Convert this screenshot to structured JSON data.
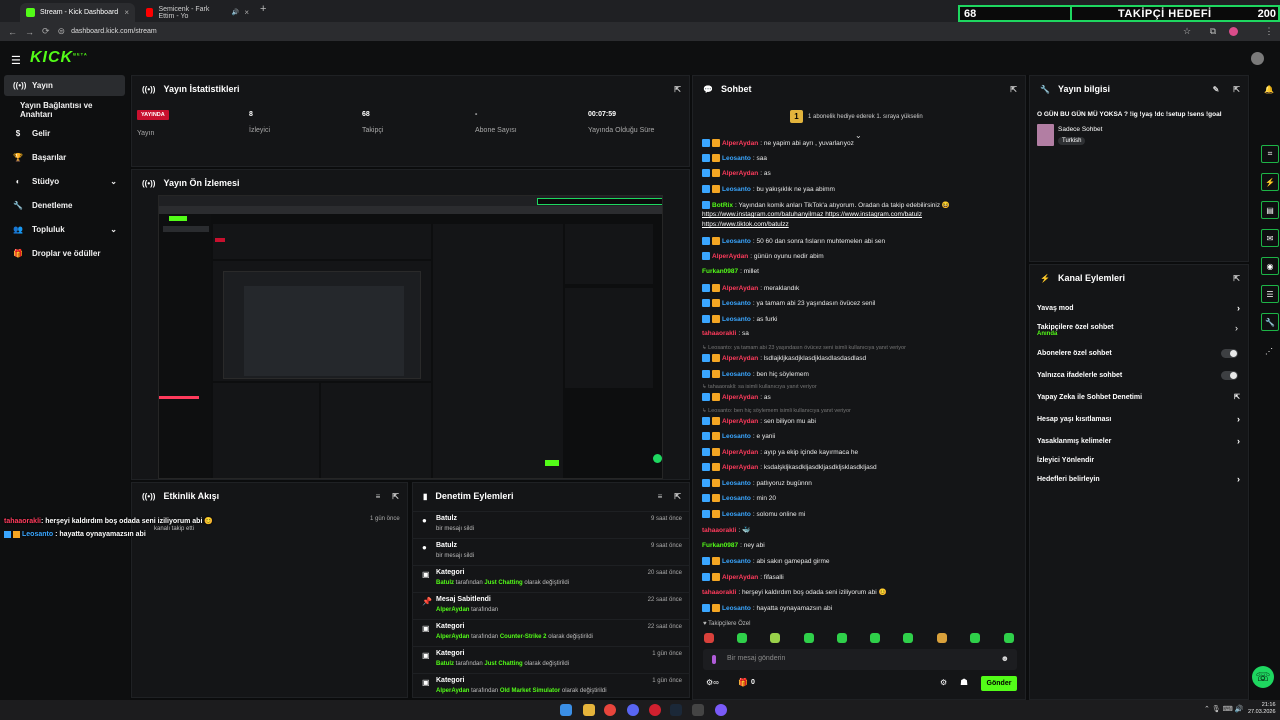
{
  "browser": {
    "tabs": [
      {
        "title": "Stream - Kick Dashboard",
        "active": true,
        "favicon_color": "#53fc18"
      },
      {
        "title": "Semicenk - Fark Ettim - Yo",
        "active": false,
        "favicon_color": "#ff0000"
      }
    ],
    "url": "dashboard.kick.com/stream"
  },
  "overlay": {
    "count": "68",
    "label": "TAKİPÇİ HEDEFİ",
    "goal": "200"
  },
  "kick": {
    "logo": "KICK",
    "beta": "BETA"
  },
  "sidebar": {
    "items": [
      {
        "label": "Yayın",
        "icon": "broadcast-icon"
      },
      {
        "label": "Yayın Bağlantısı ve Anahtarı",
        "icon": ""
      },
      {
        "label": "Gelir",
        "icon": "dollar-icon"
      },
      {
        "label": "Başarılar",
        "icon": "trophy-icon"
      },
      {
        "label": "Stüdyo",
        "icon": "palette-icon"
      },
      {
        "label": "Denetleme",
        "icon": "wrench-icon"
      },
      {
        "label": "Topluluk",
        "icon": "users-icon"
      },
      {
        "label": "Droplar ve ödüller",
        "icon": "gift-icon"
      }
    ]
  },
  "stats": {
    "title": "Yayın İstatistikleri",
    "live_badge": "YAYINDA",
    "live_label": "Yayın",
    "viewers_value": "8",
    "viewers_label": "İzleyici",
    "followers_value": "68",
    "followers_label": "Takipçi",
    "subs_value": "-",
    "subs_label": "Abone Sayısı",
    "duration_value": "00:07:59",
    "duration_label": "Yayında Olduğu Süre"
  },
  "preview": {
    "title": "Yayın Ön İzlemesi"
  },
  "activity": {
    "title": "Etkinlik Akışı",
    "item_time": "1 gün önce",
    "item_text": "kanalı takip etti",
    "overlay_msgs": [
      {
        "user": "tahaaorakli",
        "text": ": herşeyi kaldırdım boş odada seni iziliyorum abi 😊"
      },
      {
        "user": "Leosanto",
        "text": ": hayatta oynayamazsın abi"
      }
    ]
  },
  "moderation": {
    "title": "Denetim Eylemleri",
    "items": [
      {
        "icon": "user-icon",
        "title": "Batulz",
        "sub": "bir mesajı sildi",
        "time": "9 saat önce"
      },
      {
        "icon": "user-icon",
        "title": "Batulz",
        "sub": "bir mesajı sildi",
        "time": "9 saat önce"
      },
      {
        "icon": "category-icon",
        "title": "Kategori",
        "sub_user": "Batulz",
        "sub_mid": "tarafından",
        "sub_game": "Just Chatting",
        "sub_end": "olarak değiştirildi",
        "time": "20 saat önce"
      },
      {
        "icon": "pin-icon",
        "title": "Mesaj Sabitlendi",
        "sub_user": "AlperAydan",
        "sub_mid": "tarafından",
        "sub_game": "",
        "sub_end": "",
        "time": "22 saat önce"
      },
      {
        "icon": "category-icon",
        "title": "Kategori",
        "sub_user": "AlperAydan",
        "sub_mid": "tarafından",
        "sub_game": "Counter-Strike 2",
        "sub_end": "olarak değiştirildi",
        "time": "22 saat önce"
      },
      {
        "icon": "category-icon",
        "title": "Kategori",
        "sub_user": "Batulz",
        "sub_mid": "tarafından",
        "sub_game": "Just Chatting",
        "sub_end": "olarak değiştirildi",
        "time": "1 gün önce"
      },
      {
        "icon": "category-icon",
        "title": "Kategori",
        "sub_user": "AlperAydan",
        "sub_mid": "tarafından",
        "sub_game": "Old Market Simulator",
        "sub_end": "olarak değiştirildi",
        "time": "1 gün önce"
      }
    ]
  },
  "chat": {
    "title": "Sohbet",
    "gift_banner": "1 abonelik hediye ederek 1. sıraya yükselin",
    "messages": [
      {
        "user": "AlperAydan",
        "color": "#ff3b5c",
        "text": ": ne yapim abi ayrı , yuvarlarıyoz",
        "badges": 2
      },
      {
        "user": "Leosanto",
        "color": "#3aa6ff",
        "text": ": saa",
        "badges": 2
      },
      {
        "user": "AlperAydan",
        "color": "#ff3b5c",
        "text": ": as",
        "badges": 2
      },
      {
        "user": "Leosanto",
        "color": "#3aa6ff",
        "text": ": bu yakışıklık ne yaa abimm",
        "badges": 2
      },
      {
        "user": "BotRix",
        "color": "#53fc18",
        "text": ": Yayından komik anları TikTok'a atıyorum. Oradan da takip edebilirsiniz 😆",
        "badges": 1
      },
      {
        "user": "",
        "color": "#fff",
        "text": "https://www.instagram.com/batuhanyilmaz https://www.instagram.com/batulz",
        "badges": 0
      },
      {
        "user": "",
        "color": "#fff",
        "text": "https://www.tiktok.com/batulzz",
        "badges": 0
      },
      {
        "user": "Leosanto",
        "color": "#3aa6ff",
        "text": ": 50 60 dan sonra fısların muhtemelen abi sen",
        "badges": 2
      },
      {
        "user": "AlperAydan",
        "color": "#ff3b5c",
        "text": ": günün oyunu nedir abim",
        "badges": 1
      },
      {
        "user": "Furkan0987",
        "color": "#53fc18",
        "text": ": millet",
        "badges": 0
      },
      {
        "user": "AlperAydan",
        "color": "#ff3b5c",
        "text": ": meraklandık",
        "badges": 2
      },
      {
        "user": "Leosanto",
        "color": "#3aa6ff",
        "text": ": ya tamam abi 23 yaşındasın övücez senil",
        "badges": 2
      },
      {
        "user": "Leosanto",
        "color": "#3aa6ff",
        "text": ": as furki",
        "badges": 2
      },
      {
        "user": "tahaaorakli",
        "color": "#ff3b5c",
        "text": ": sa",
        "badges": 0
      },
      {
        "user": "",
        "color": "#777",
        "text": "↳ Leosanto: ya tamam abi 23 yaşındasın övücez seni isimli kullanıcıya yanıt veriyor",
        "badges": 0
      },
      {
        "user": "AlperAydan",
        "color": "#ff3b5c",
        "text": ": lsdlajkljkasdjklasdjklasdlasdasdlasd",
        "badges": 2
      },
      {
        "user": "Leosanto",
        "color": "#3aa6ff",
        "text": ": ben hiç söylemem",
        "badges": 2
      },
      {
        "user": "",
        "color": "#777",
        "text": "↳ tahaaorakli: sa isimli kullanıcıya yanıt veriyor",
        "badges": 0
      },
      {
        "user": "AlperAydan",
        "color": "#ff3b5c",
        "text": ": as",
        "badges": 2
      },
      {
        "user": "",
        "color": "#777",
        "text": "↳ Leosanto: ben hiç söylemem isimli kullanıcıya yanıt veriyor",
        "badges": 0
      },
      {
        "user": "AlperAydan",
        "color": "#ff3b5c",
        "text": ": sen biliyon mu abi",
        "badges": 2
      },
      {
        "user": "Leosanto",
        "color": "#3aa6ff",
        "text": ": e yanii",
        "badges": 2
      },
      {
        "user": "AlperAydan",
        "color": "#ff3b5c",
        "text": ": ayıp ya ekip içinde kayırmaca he",
        "badges": 2
      },
      {
        "user": "AlperAydan",
        "color": "#ff3b5c",
        "text": ": ksdalşkljkasdkljasdkljasdkljsklasdkljasd",
        "badges": 2
      },
      {
        "user": "Leosanto",
        "color": "#3aa6ff",
        "text": ": patlıyoruz bugünnn",
        "badges": 2
      },
      {
        "user": "Leosanto",
        "color": "#3aa6ff",
        "text": ": min 20",
        "badges": 2
      },
      {
        "user": "Leosanto",
        "color": "#3aa6ff",
        "text": ": solomu online mi",
        "badges": 2
      },
      {
        "user": "tahaaorakli",
        "color": "#ff3b5c",
        "text": ": 🐳",
        "badges": 0
      },
      {
        "user": "Furkan0987",
        "color": "#53fc18",
        "text": ": ney abi",
        "badges": 0
      },
      {
        "user": "Leosanto",
        "color": "#3aa6ff",
        "text": ": abi sakın gamepad girme",
        "badges": 2
      },
      {
        "user": "AlperAydan",
        "color": "#ff3b5c",
        "text": ": fifasalli",
        "badges": 2
      },
      {
        "user": "tahaaorakli",
        "color": "#ff3b5c",
        "text": ": herşeyi kaldırdım boş odada seni iziliyorum abi 😊",
        "badges": 0
      },
      {
        "user": "Leosanto",
        "color": "#3aa6ff",
        "text": ": hayatta oynayamazsın abi",
        "badges": 2
      }
    ],
    "followers_only": "♥ Takipçilere Özel",
    "input_placeholder": "Bir mesaj gönderin",
    "footer_count": "0",
    "send_label": "Gönder"
  },
  "stream_info": {
    "title": "Yayın bilgisi",
    "stream_title": "O GÜN BU GÜN MÜ YOKSA ? !ig !yaş !dc !setup !sens !goal",
    "category": "Sadece Sohbet",
    "language": "Turkish"
  },
  "channel_actions": {
    "title": "Kanal Eylemleri",
    "items": [
      {
        "label": "Yavaş mod",
        "type": "chevron",
        "sub": ""
      },
      {
        "label": "Takipçilere özel sohbet",
        "type": "chevron",
        "sub": "Anında"
      },
      {
        "label": "Abonelere özel sohbet",
        "type": "toggle",
        "sub": ""
      },
      {
        "label": "Yalnızca ifadelerle sohbet",
        "type": "toggle",
        "sub": ""
      },
      {
        "label": "Yapay Zeka ile Sohbet Denetimi",
        "type": "external",
        "sub": ""
      },
      {
        "label": "Hesap yaşı kısıtlaması",
        "type": "chevron",
        "sub": ""
      },
      {
        "label": "Yasaklanmış kelimeler",
        "type": "chevron",
        "sub": ""
      },
      {
        "label": "İzleyici Yönlendir",
        "type": "none",
        "sub": ""
      },
      {
        "label": "Hedefleri belirleyin",
        "type": "chevron",
        "sub": ""
      }
    ]
  },
  "taskbar": {
    "time": "21:16",
    "date": "27.03.2026"
  }
}
